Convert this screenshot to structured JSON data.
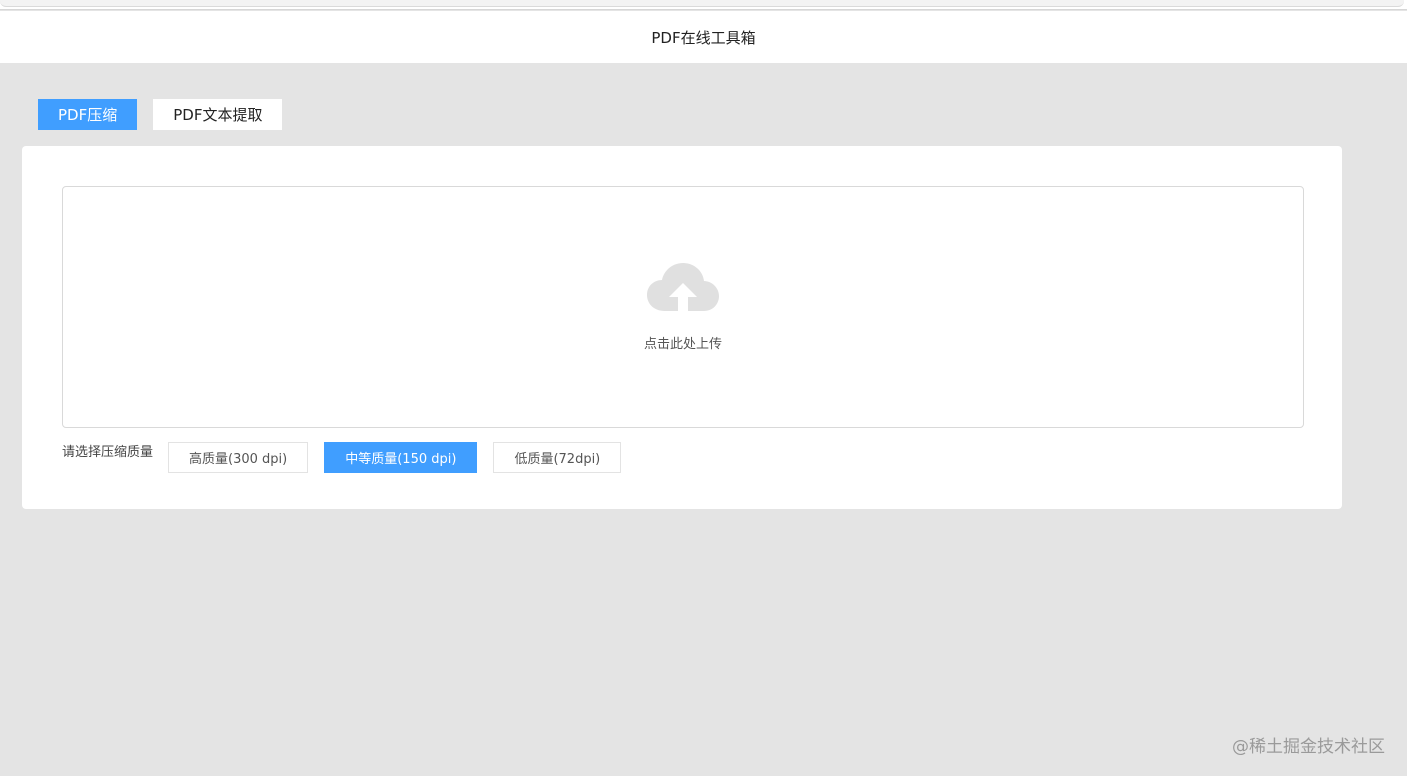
{
  "header": {
    "title": "PDF在线工具箱"
  },
  "tabs": [
    {
      "label": "PDF压缩",
      "active": true
    },
    {
      "label": "PDF文本提取",
      "active": false
    }
  ],
  "upload": {
    "icon": "cloud-upload-icon",
    "text": "点击此处上传"
  },
  "quality": {
    "label": "请选择压缩质量",
    "options": [
      {
        "label": "高质量(300 dpi)",
        "selected": false
      },
      {
        "label": "中等质量(150 dpi)",
        "selected": true
      },
      {
        "label": "低质量(72dpi)",
        "selected": false
      }
    ]
  },
  "watermark": {
    "text": "@稀土掘金技术社区"
  },
  "colors": {
    "accent": "#409eff",
    "background": "#e4e4e4",
    "icon": "#e0e0e0"
  }
}
